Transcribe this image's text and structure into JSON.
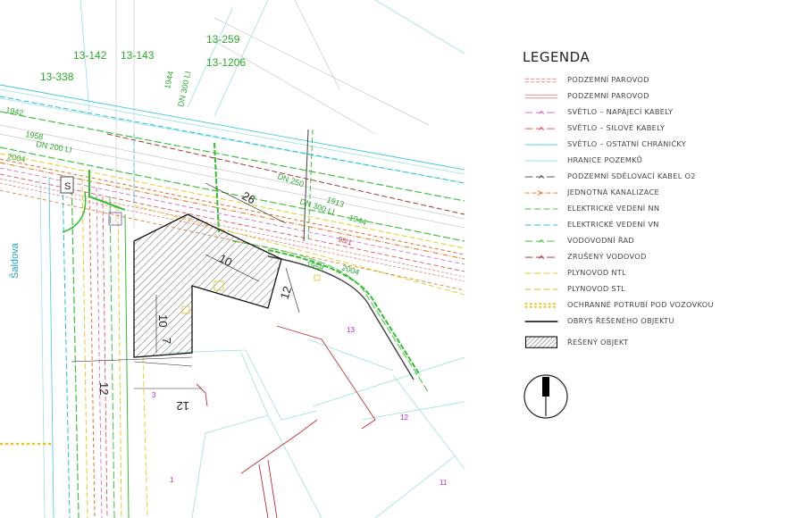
{
  "legend": {
    "title": "LEGENDA",
    "items": [
      {
        "label": "PODZEMNÍ PAROVOD",
        "color": "#e88080",
        "style": "double-dash"
      },
      {
        "label": "PODZEMNÍ PAROVOD",
        "color": "#e88080",
        "style": "double-solid"
      },
      {
        "label": "SVĚTLO – NAPÁJECÍ KABELY",
        "color": "#d060c0",
        "style": "dash-mark"
      },
      {
        "label": "SVĚTLO – SILOVÉ KABELY",
        "color": "#e04040",
        "style": "dash-mark"
      },
      {
        "label": "SVĚTLO – OSTATNÍ CHRÁNIČKY",
        "color": "#40c8e0",
        "style": "solid"
      },
      {
        "label": "HRANICE POZEMKŮ",
        "color": "#80e0e0",
        "style": "solid"
      },
      {
        "label": "PODZEMNÍ SDĚLOVACÍ KABEL O2",
        "color": "#404040",
        "style": "dash-mark"
      },
      {
        "label": "JEDNOTNÁ KANALIZACE",
        "color": "#e07020",
        "style": "arrow-dash"
      },
      {
        "label": "ELEKTRICKÉ VEDENÍ NN",
        "color": "#40c040",
        "style": "dash"
      },
      {
        "label": "ELEKTRICKÉ VEDENÍ VN",
        "color": "#20c0e0",
        "style": "dash"
      },
      {
        "label": "VODOVODNÍ ŘAD",
        "color": "#30c030",
        "style": "dash-mark"
      },
      {
        "label": "ZRUŠENÝ VODOVOD",
        "color": "#a02020",
        "style": "dash-mark"
      },
      {
        "label": "PLYNOVOD NTL",
        "color": "#e0d020",
        "style": "dash"
      },
      {
        "label": "PLYNOVOD STL",
        "color": "#d0c020",
        "style": "dash"
      },
      {
        "label": "OCHRANNÉ POTRUBÍ POD VOZOVKOU",
        "color": "#f0c020",
        "style": "thick-dash"
      },
      {
        "label": "OBRYS ŘEŠENÉHO OBJEKTU",
        "color": "#000000",
        "style": "solid-thick"
      },
      {
        "label": "ŘEŠENÝ OBJEKT",
        "color": "#000000",
        "style": "hatch"
      }
    ]
  },
  "map": {
    "parcel_labels": [
      "13-142",
      "13-143",
      "13-259",
      "13-1206",
      "13-338"
    ],
    "green_labels": [
      "1942",
      "1958",
      "DN 200 LI",
      "2004",
      "1944",
      "DN 300 LI",
      "1913",
      "DN 250",
      "DN 300 LI",
      "1944",
      "1958",
      "2004"
    ],
    "street_name": "Šaldova",
    "parcel_numbers": [
      "13",
      "12",
      "11",
      "3",
      "1"
    ],
    "sewer_label": "95/1",
    "marker_label": "S",
    "dimensions": [
      "10",
      "26",
      "12",
      "10",
      "12",
      "12",
      "7"
    ]
  }
}
